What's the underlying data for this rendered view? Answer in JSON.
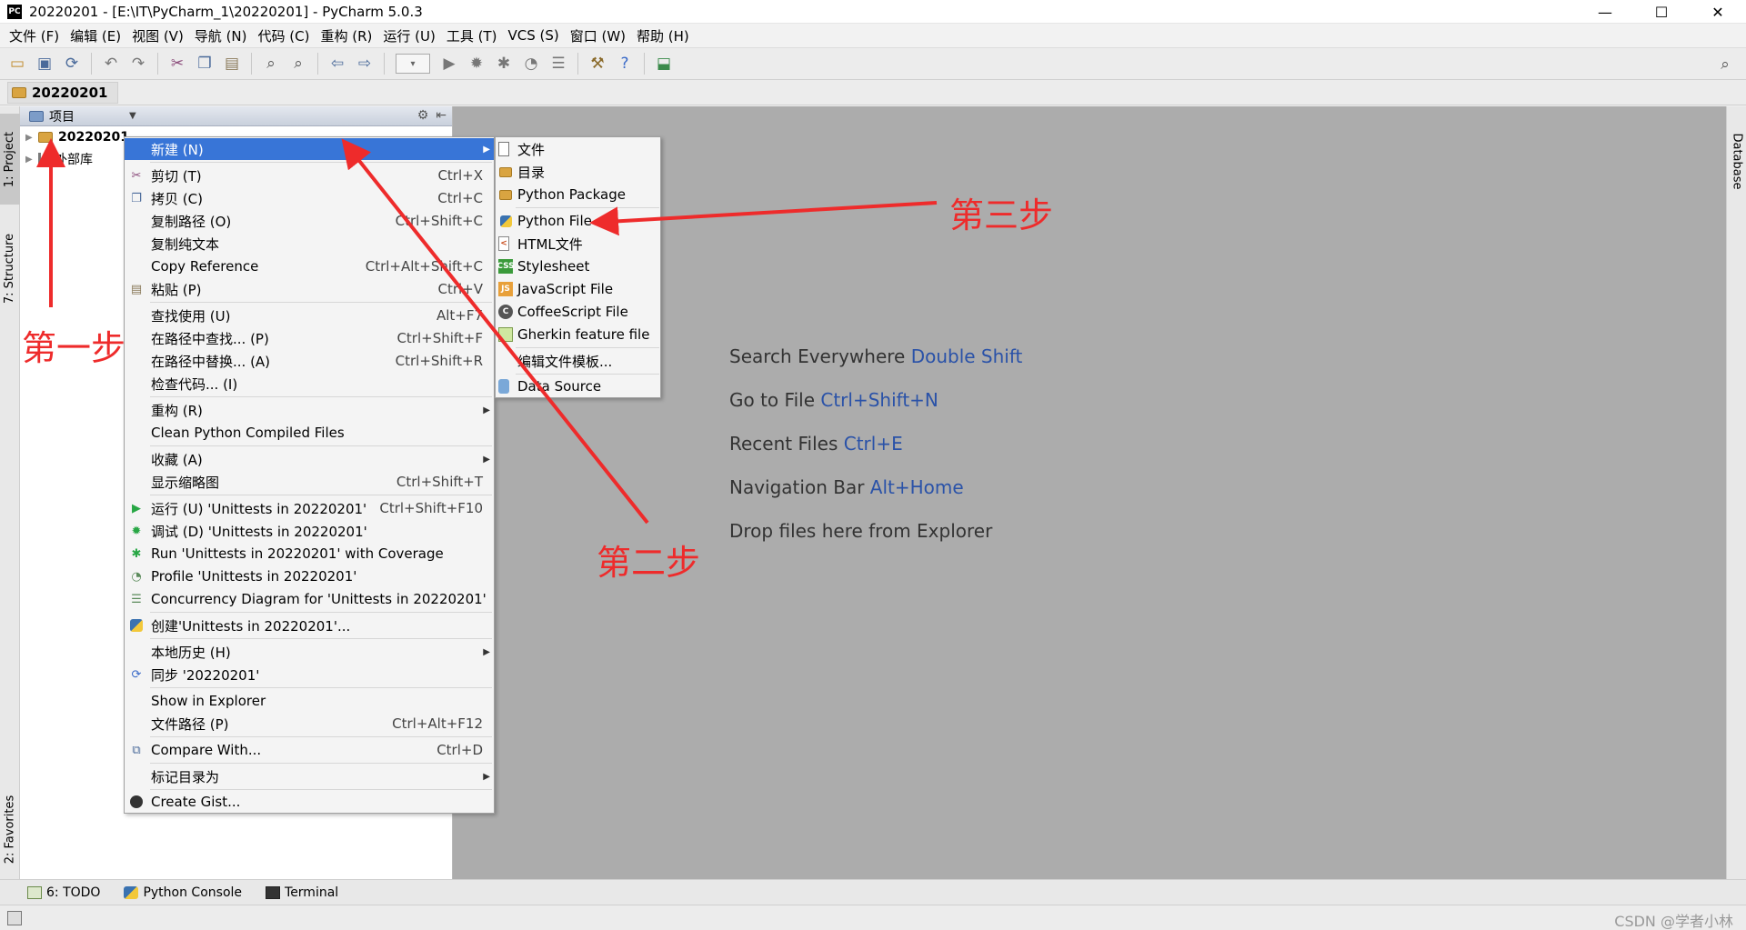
{
  "window": {
    "title": "20220201 - [E:\\IT\\PyCharm_1\\20220201] - PyCharm 5.0.3",
    "app_icon_text": "PC",
    "minimize": "—",
    "maximize": "☐",
    "close": "✕"
  },
  "menubar": [
    "文件 (F)",
    "编辑 (E)",
    "视图 (V)",
    "导航 (N)",
    "代码 (C)",
    "重构 (R)",
    "运行 (U)",
    "工具 (T)",
    "VCS (S)",
    "窗口 (W)",
    "帮助 (H)"
  ],
  "navbar": {
    "crumb": "20220201"
  },
  "left_tabs": {
    "project": "1: Project",
    "structure": "7: Structure",
    "favorites": "2: Favorites"
  },
  "right_tabs": {
    "database": "Database"
  },
  "project_panel": {
    "header": "项目",
    "tree": [
      {
        "label": "20220201"
      },
      {
        "label": "外部库"
      }
    ]
  },
  "editor_hints": [
    {
      "text": "Search Everywhere",
      "shortcut": "Double Shift"
    },
    {
      "text": "Go to File",
      "shortcut": "Ctrl+Shift+N"
    },
    {
      "text": "Recent Files",
      "shortcut": "Ctrl+E"
    },
    {
      "text": "Navigation Bar",
      "shortcut": "Alt+Home"
    },
    {
      "text": "Drop files here from Explorer",
      "shortcut": ""
    }
  ],
  "context_menu": {
    "new": {
      "label": "新建 (N)"
    },
    "cut": {
      "label": "剪切 (T)",
      "shortcut": "Ctrl+X"
    },
    "copy": {
      "label": "拷贝 (C)",
      "shortcut": "Ctrl+C"
    },
    "copy_path": {
      "label": "复制路径 (O)",
      "shortcut": "Ctrl+Shift+C"
    },
    "copy_plain": {
      "label": "复制纯文本",
      "shortcut": ""
    },
    "copy_reference": {
      "label": "Copy Reference",
      "shortcut": "Ctrl+Alt+Shift+C"
    },
    "paste": {
      "label": "粘贴 (P)",
      "shortcut": "Ctrl+V"
    },
    "find_usages": {
      "label": "查找使用 (U)",
      "shortcut": "Alt+F7"
    },
    "find_in_path": {
      "label": "在路径中查找... (P)",
      "shortcut": "Ctrl+Shift+F"
    },
    "replace_in_path": {
      "label": "在路径中替换... (A)",
      "shortcut": "Ctrl+Shift+R"
    },
    "inspect_code": {
      "label": "检查代码... (I)",
      "shortcut": ""
    },
    "refactor": {
      "label": "重构 (R)"
    },
    "clean_compiled": {
      "label": "Clean Python Compiled Files"
    },
    "favorites": {
      "label": "收藏 (A)"
    },
    "thumbnails": {
      "label": "显示缩略图",
      "shortcut": "Ctrl+Shift+T"
    },
    "run": {
      "label": "运行 (U) 'Unittests in 20220201'",
      "shortcut": "Ctrl+Shift+F10"
    },
    "debug": {
      "label": "调试 (D) 'Unittests in 20220201'"
    },
    "run_coverage": {
      "label": "Run 'Unittests in 20220201' with Coverage"
    },
    "profile": {
      "label": "Profile 'Unittests in 20220201'"
    },
    "concurrency": {
      "label": "Concurrency Diagram for  'Unittests in 20220201'"
    },
    "create_config": {
      "label": "创建'Unittests in 20220201'..."
    },
    "local_history": {
      "label": "本地历史 (H)"
    },
    "sync": {
      "label": "同步 '20220201'"
    },
    "show_explorer": {
      "label": "Show in Explorer"
    },
    "file_path": {
      "label": "文件路径 (P)",
      "shortcut": "Ctrl+Alt+F12"
    },
    "compare_with": {
      "label": "Compare With...",
      "shortcut": "Ctrl+D"
    },
    "mark_dir": {
      "label": "标记目录为"
    },
    "create_gist": {
      "label": "Create Gist..."
    }
  },
  "submenu": [
    "文件",
    "目录",
    "Python Package",
    "Python File",
    "HTML文件",
    "Stylesheet",
    "JavaScript File",
    "CoffeeScript File",
    "Gherkin feature file",
    "编辑文件模板...",
    "Data Source"
  ],
  "bottom_tabs": {
    "todo": "6: TODO",
    "python_console": "Python Console",
    "terminal": "Terminal"
  },
  "watermark": "CSDN @学者小林",
  "annotations": {
    "step1": "第一步",
    "step2": "第二步",
    "step3": "第三步"
  },
  "colors": {
    "menu_highlight": "#3875d7",
    "arrow": "#ee2b2b",
    "shortcut_link": "#2a52a8",
    "editor_bg": "#acacac"
  }
}
